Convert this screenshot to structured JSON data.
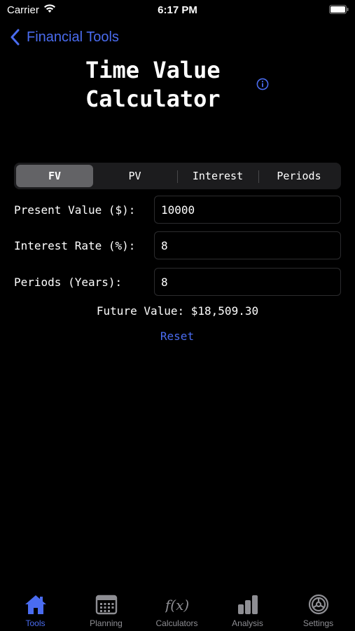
{
  "status_bar": {
    "carrier": "Carrier",
    "time": "6:17 PM"
  },
  "nav": {
    "back_label": "Financial Tools"
  },
  "title": {
    "line1": "Time Value",
    "line2": "Calculator"
  },
  "segments": {
    "selected": "FV",
    "items": [
      {
        "label": "FV"
      },
      {
        "label": "PV"
      },
      {
        "label": "Interest"
      },
      {
        "label": "Periods"
      }
    ]
  },
  "form": {
    "present_value": {
      "label": "Present Value ($):",
      "value": "10000"
    },
    "interest_rate": {
      "label": "Interest Rate (%):",
      "value": "8"
    },
    "periods": {
      "label": "Periods (Years):",
      "value": "8"
    }
  },
  "result": {
    "text": "Future Value: $18,509.30"
  },
  "reset_label": "Reset",
  "tabs": {
    "active": "Tools",
    "items": [
      {
        "label": "Tools",
        "icon": "home-icon"
      },
      {
        "label": "Planning",
        "icon": "calendar-icon"
      },
      {
        "label": "Calculators",
        "icon": "function-icon"
      },
      {
        "label": "Analysis",
        "icon": "bar-chart-icon"
      },
      {
        "label": "Settings",
        "icon": "gear-icon"
      }
    ]
  },
  "colors": {
    "accent": "#4a6cf0",
    "background": "#000000",
    "segment_bg": "#1c1c1e",
    "segment_selected": "#636366",
    "inactive_tab": "#8e8e93"
  }
}
